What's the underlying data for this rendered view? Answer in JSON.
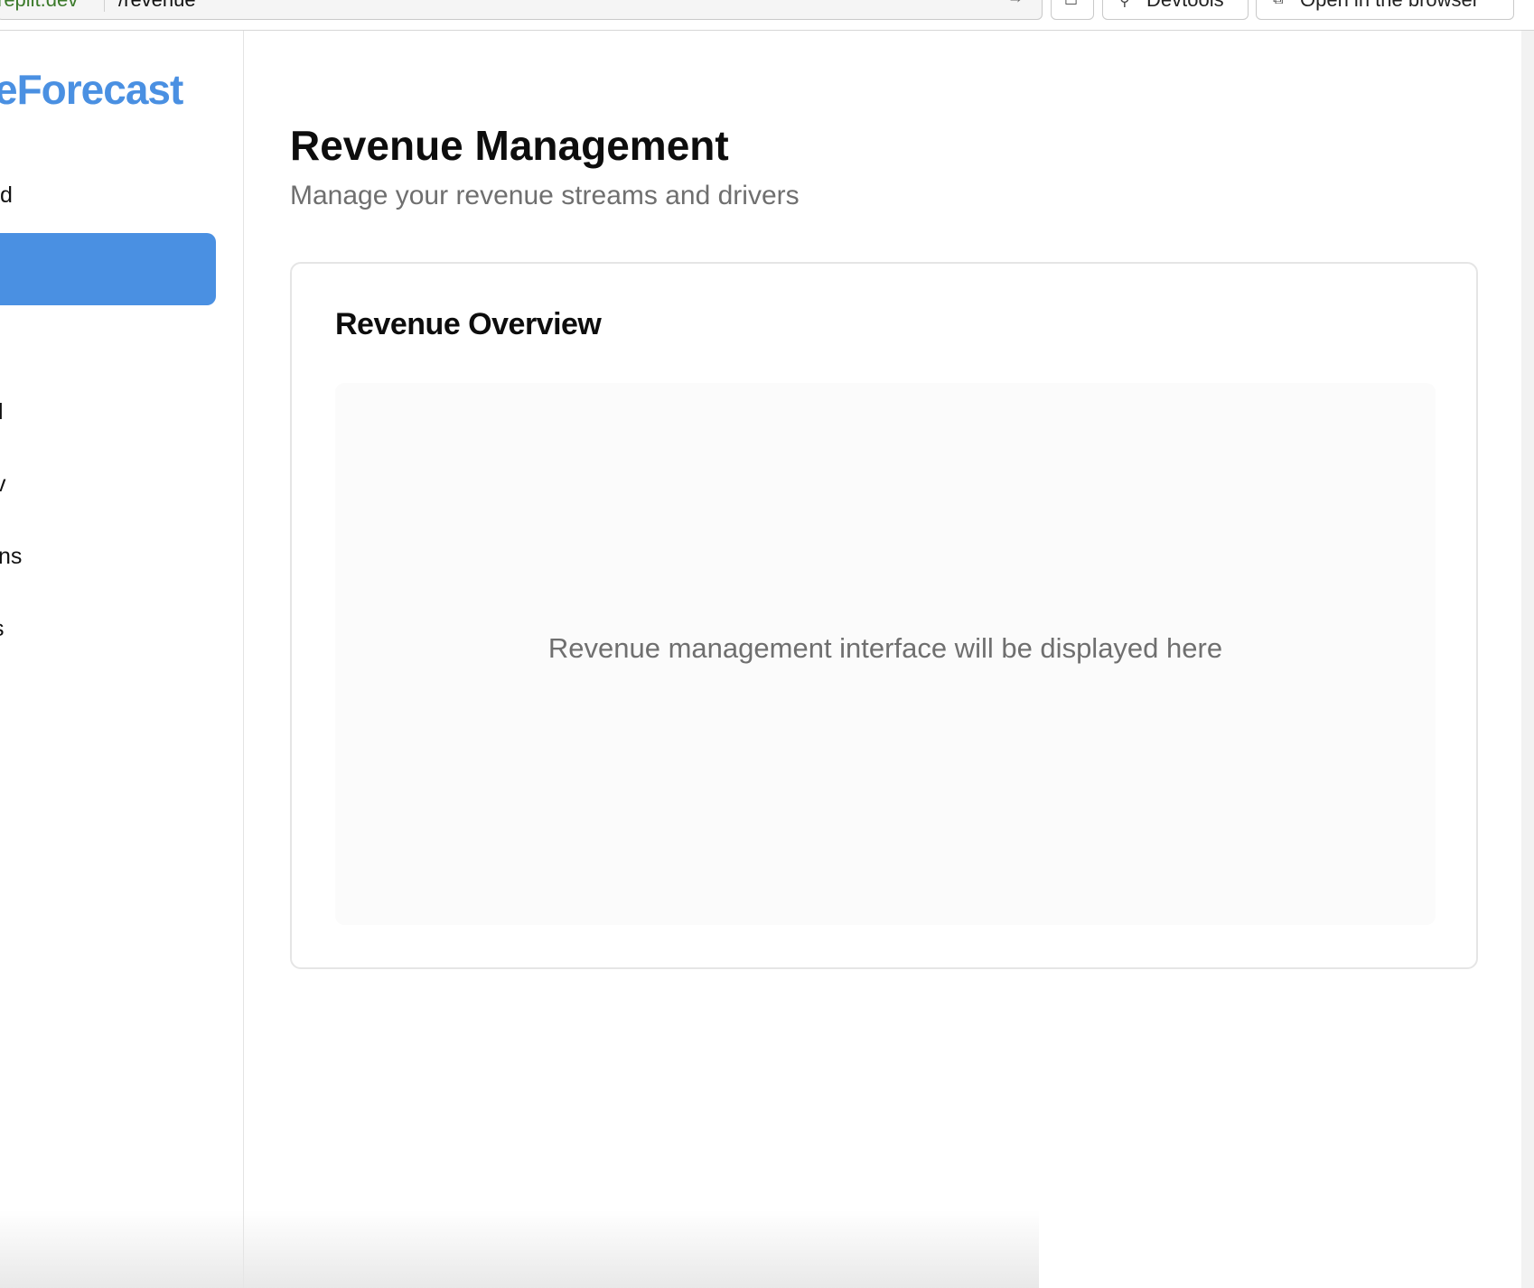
{
  "browser": {
    "domain": "replit.dev",
    "path": "/revenue",
    "buttons": {
      "devtools": "Devtools",
      "open_in_browser": "Open in the browser"
    }
  },
  "sidebar": {
    "brand": "eForecast",
    "items": [
      {
        "label": "d",
        "active": false
      },
      {
        "label": "",
        "active": true
      },
      {
        "label": "l",
        "active": false
      },
      {
        "label": "v",
        "active": false
      },
      {
        "label": "ns",
        "active": false
      },
      {
        "label": "s",
        "active": false
      }
    ],
    "accent_color": "#4a90e2"
  },
  "page": {
    "title": "Revenue Management",
    "subtitle": "Manage your revenue streams and drivers",
    "card": {
      "title": "Revenue Overview",
      "placeholder": "Revenue management interface will be displayed here"
    }
  }
}
